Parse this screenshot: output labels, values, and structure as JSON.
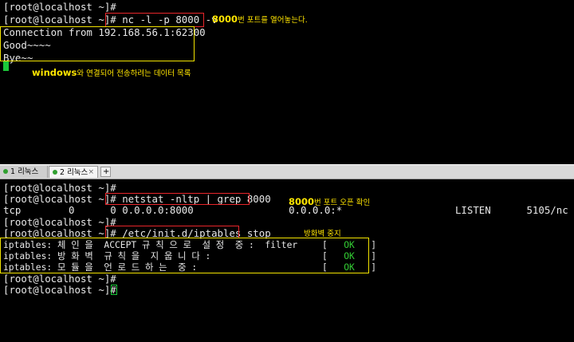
{
  "top": {
    "lines": [
      "[root@localhost ~]#",
      "[root@localhost ~]# nc -l -p 8000 -v",
      "Connection from 192.168.56.1:62300",
      "Good~~~~",
      "Bye~~"
    ],
    "anno_port_num": "8000",
    "anno_port_text": "번 포트를 열어놓는다.",
    "anno_windows_word": "windows",
    "anno_windows_text": "와 연결되어 전송하려는 데이터 목록"
  },
  "tabs": [
    {
      "label": "1 리눅스",
      "color": "#30a030"
    },
    {
      "label": "2 리눅스",
      "color": "#30a030"
    }
  ],
  "tab_add": "+",
  "tab_close": "×",
  "bottom": {
    "lines": [
      "[root@localhost ~]#",
      "[root@localhost ~]# netstat -nltp | grep 8000",
      "tcp        0      0 0.0.0.0:8000                0.0.0.0:*                   LISTEN      5105/nc",
      "[root@localhost ~]#",
      "[root@localhost ~]# /etc/init.d/iptables stop"
    ],
    "iptables_lines": [
      {
        "text": "iptables: 체 인 을  ACCEPT 규 칙 으 로  설 정  중 :  filter",
        "open": "[",
        "status": "OK",
        "close": "]"
      },
      {
        "text": "iptables: 방 화 벽  규 칙 을  지 웁 니 다 :",
        "open": "[",
        "status": "OK",
        "close": "]"
      },
      {
        "text": "iptables: 모 듈 을  언 로 드 하 는  중 :",
        "open": "[",
        "status": "OK",
        "close": "]"
      }
    ],
    "prompt_lines": [
      "[root@localhost ~]#",
      "[root@localhost ~]#"
    ],
    "anno_port_num": "8000",
    "anno_port_text": "번 포트 오픈 확인",
    "anno_firewall": "방화벽 중지"
  },
  "colors": {
    "annotation": "#ffe500",
    "red_box": "#e8252a",
    "yellow_box": "#f2e300",
    "ok_green": "#33cc33",
    "cursor": "#1cc83a"
  }
}
